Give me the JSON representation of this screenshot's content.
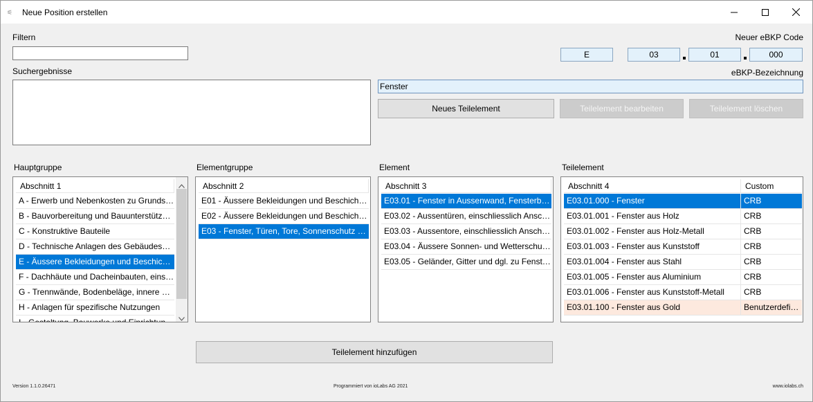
{
  "window": {
    "title": "Neue Position erstellen"
  },
  "filter": {
    "label": "Filtern",
    "value": ""
  },
  "search_results": {
    "label": "Suchergebnisse"
  },
  "ebkp": {
    "code_label": "Neuer eBKP Code",
    "code_parts": [
      "E",
      "03",
      "01",
      "000"
    ],
    "designation_label": "eBKP-Bezeichnung",
    "designation_value": "Fenster"
  },
  "buttons": {
    "new_sub_element": "Neues Teilelement",
    "edit_sub_element": "Teilelement bearbeiten",
    "delete_sub_element": "Teilelement löschen",
    "add_sub_element": "Teilelement hinzufügen"
  },
  "hauptgruppe": {
    "label": "Hauptgruppe",
    "header": "Abschnitt 1",
    "selected_index": 4,
    "items": [
      "A - Erwerb und Nebenkosten zu Grundstück ...",
      "B - Bauvorbereitung und Bauunterstützung",
      "C - Konstruktive Bauteile",
      "D - Technische Anlagen des GebäudesErsc...",
      "E - Äussere Bekleidungen und Beschichtung...",
      "F - Dachhäute und Dacheinbauten, einschlie...",
      "G - Trennwände, Bodenbeläge, innere Beklei...",
      "H - Anlagen für spezifische Nutzungen",
      "I - Gestaltung, Bauwerke und Einrichtungen i..."
    ]
  },
  "elementgruppe": {
    "label": "Elementgruppe",
    "header": "Abschnitt 2",
    "selected_index": 2,
    "items": [
      "E01 - Äussere Bekleidungen und Beschichtunge...",
      "E02 - Äussere Bekleidungen und Beschichtunge...",
      "E03 - Fenster, Türen, Tore, Sonnenschutz und d..."
    ]
  },
  "element": {
    "label": "Element",
    "header": "Abschnitt 3",
    "selected_index": 0,
    "items": [
      "E03.01 - Fenster in Aussenwand, Fensterbänke, ...",
      "E03.02 - Aussentüren, einschliesslich Anschlüss...",
      "E03.03 - Aussentore, einschliesslich Anschlüsse,...",
      "E03.04 - Äussere Sonnen- und Wetterschutzanl...",
      "E03.05 - Geländer, Gitter und dgl. zu FensterAus..."
    ]
  },
  "teilelement": {
    "label": "Teilelement",
    "header": "Abschnitt 4",
    "header_custom": "Custom",
    "selected_index": 0,
    "rows": [
      {
        "name": "E03.01.000 - Fenster",
        "custom": "CRB"
      },
      {
        "name": "E03.01.001 - Fenster aus Holz",
        "custom": "CRB"
      },
      {
        "name": "E03.01.002 - Fenster aus Holz-Metall",
        "custom": "CRB"
      },
      {
        "name": "E03.01.003 - Fenster aus Kunststoff",
        "custom": "CRB"
      },
      {
        "name": "E03.01.004 - Fenster aus Stahl",
        "custom": "CRB"
      },
      {
        "name": "E03.01.005 - Fenster aus Aluminium",
        "custom": "CRB"
      },
      {
        "name": "E03.01.006 - Fenster aus Kunststoff-Metall",
        "custom": "CRB"
      },
      {
        "name": "E03.01.100 - Fenster aus Gold",
        "custom": "Benutzerdefiniert"
      }
    ]
  },
  "footer": {
    "version": "Version 1.1.0.26471",
    "credit": "Programmiert von ioLabs AG 2021",
    "website": "www.iolabs.ch"
  },
  "colors": {
    "selection": "#0078d7",
    "custom_row": "#fde9de",
    "code_box": "#e3f1fb"
  }
}
